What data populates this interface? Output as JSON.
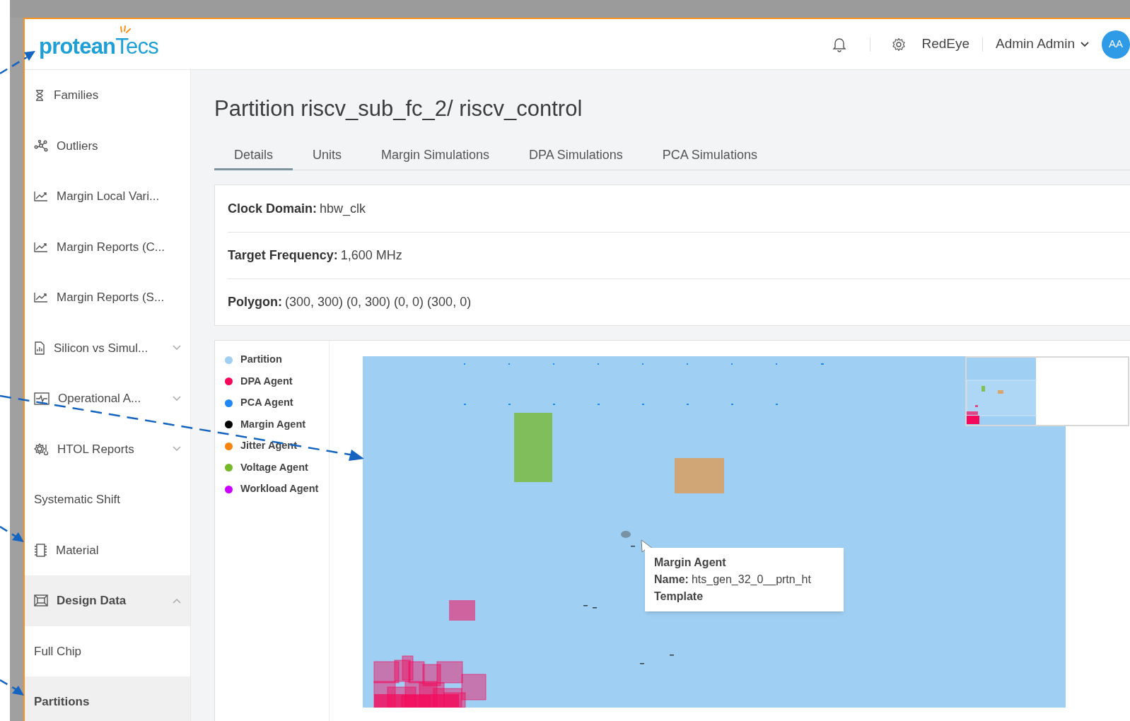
{
  "header": {
    "logo": "**protean**Tecs",
    "workspace": "RedEye",
    "user": "Admin Admin",
    "avatar": "AA"
  },
  "sidebar": {
    "items": [
      {
        "label": "Families",
        "selected": false
      },
      {
        "label": "Outliers",
        "selected": false
      },
      {
        "label": "Margin Local Vari...",
        "selected": false
      },
      {
        "label": "Margin Reports (C...",
        "selected": false
      },
      {
        "label": "Margin Reports (S...",
        "selected": false
      },
      {
        "label": "Silicon vs Simul...",
        "selected": false,
        "expanded": false
      },
      {
        "label": "Operational A...",
        "selected": false,
        "expanded": false
      },
      {
        "label": "HTOL Reports",
        "selected": false,
        "expanded": false
      },
      {
        "label": "Systematic Shift",
        "selected": false
      },
      {
        "label": "Material",
        "selected": false
      },
      {
        "label": "Design Data",
        "selected": true,
        "expanded": true,
        "children": [
          {
            "label": "Full Chip",
            "selected": false
          },
          {
            "label": "Partitions",
            "selected": true
          }
        ]
      }
    ]
  },
  "page": {
    "title": "Partition riscv_sub_fc_2/ riscv_control",
    "tabs": [
      {
        "label": "Details",
        "selected": true
      },
      {
        "label": "Units",
        "selected": false
      },
      {
        "label": "Margin Simulations",
        "selected": false
      },
      {
        "label": "DPA Simulations",
        "selected": false
      },
      {
        "label": "PCA Simulations",
        "selected": false
      }
    ],
    "details": [
      {
        "label": "Clock Domain:",
        "value": "hbw_clk"
      },
      {
        "label": "Target Frequency:",
        "value": "1,600 MHz"
      },
      {
        "label": "Polygon:",
        "value": "(300, 300) (0, 300) (0, 0) (300, 0)"
      }
    ],
    "legend": {
      "items": [
        {
          "label": "Partition",
          "color": "#9fd0f3"
        },
        {
          "label": "DPA Agent",
          "color": "#f5095a"
        },
        {
          "label": "PCA Agent",
          "color": "#1e88f5"
        },
        {
          "label": "Margin Agent",
          "color": "#000000"
        },
        {
          "label": "Jitter Agent",
          "color": "#f7840f"
        },
        {
          "label": "Voltage Agent",
          "color": "#76b82a"
        },
        {
          "label": "Workload Agent",
          "color": "#cc00ff"
        }
      ]
    },
    "tooltip": {
      "title": "Margin Agent",
      "name_label": "Name:",
      "name_value": "hts_gen_32_0__prtn_ht",
      "footer": "Template"
    }
  }
}
